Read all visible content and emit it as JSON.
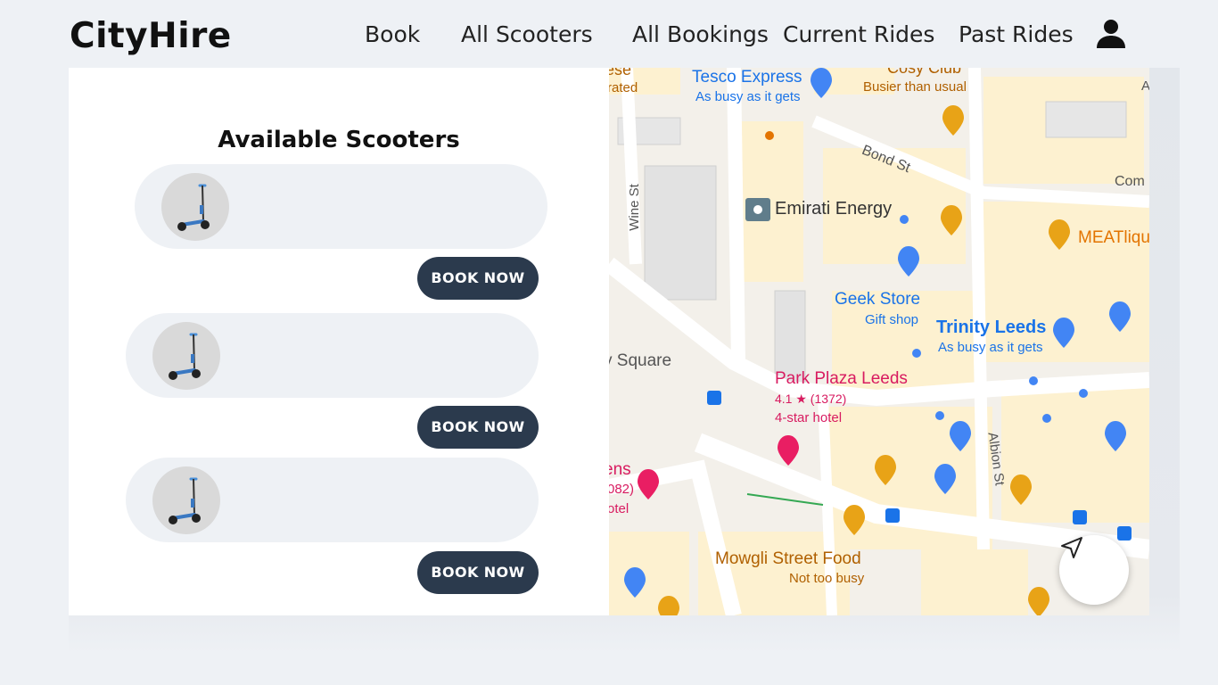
{
  "app": {
    "brand": "CityHire"
  },
  "nav": {
    "book": "Book",
    "all_scooters": "All Scooters",
    "all_bookings": "All Bookings",
    "current_rides": "Current Rides",
    "past_rides": "Past Rides",
    "user_icon": "user-icon"
  },
  "scooters": {
    "title": "Available Scooters",
    "items": [
      {
        "image": "scooter-image",
        "button": "BOOK NOW"
      },
      {
        "image": "scooter-image",
        "button": "BOOK NOW"
      },
      {
        "image": "scooter-image",
        "button": "BOOK NOW"
      }
    ]
  },
  "map": {
    "labels": {
      "ese": "ese",
      "rated": "rated",
      "tesco": "Tesco Express",
      "tesco_status": "As busy as it gets",
      "cosy": "Cosy Club",
      "cosy_status": "Busier than usual",
      "a_edge": "A",
      "bond_st": "Bond St",
      "com": "Com",
      "wine_st": "Wine St",
      "emirati": "Emirati Energy",
      "meat": "MEATliqu",
      "geek": "Geek Store",
      "geek_sub": "Gift shop",
      "trinity": "Trinity Leeds",
      "trinity_status": "As busy as it gets",
      "square": "y Square",
      "park_plaza": "Park Plaza Leeds",
      "park_rating": "4.1 ★ (1372)",
      "park_sub": "4-star hotel",
      "ens": "ens",
      "n082": "082)",
      "otel": "otel",
      "albion": "Albion St",
      "mowgli": "Mowgli Street Food",
      "mowgli_status": "Not too busy"
    },
    "recenter_icon": "navigation-arrow-icon"
  },
  "colors": {
    "button": "#2b3a4d",
    "card": "#eef1f5",
    "poi_blue": "#1a73e8",
    "poi_orange": "#e37400",
    "hotel_pink": "#d81b60"
  }
}
